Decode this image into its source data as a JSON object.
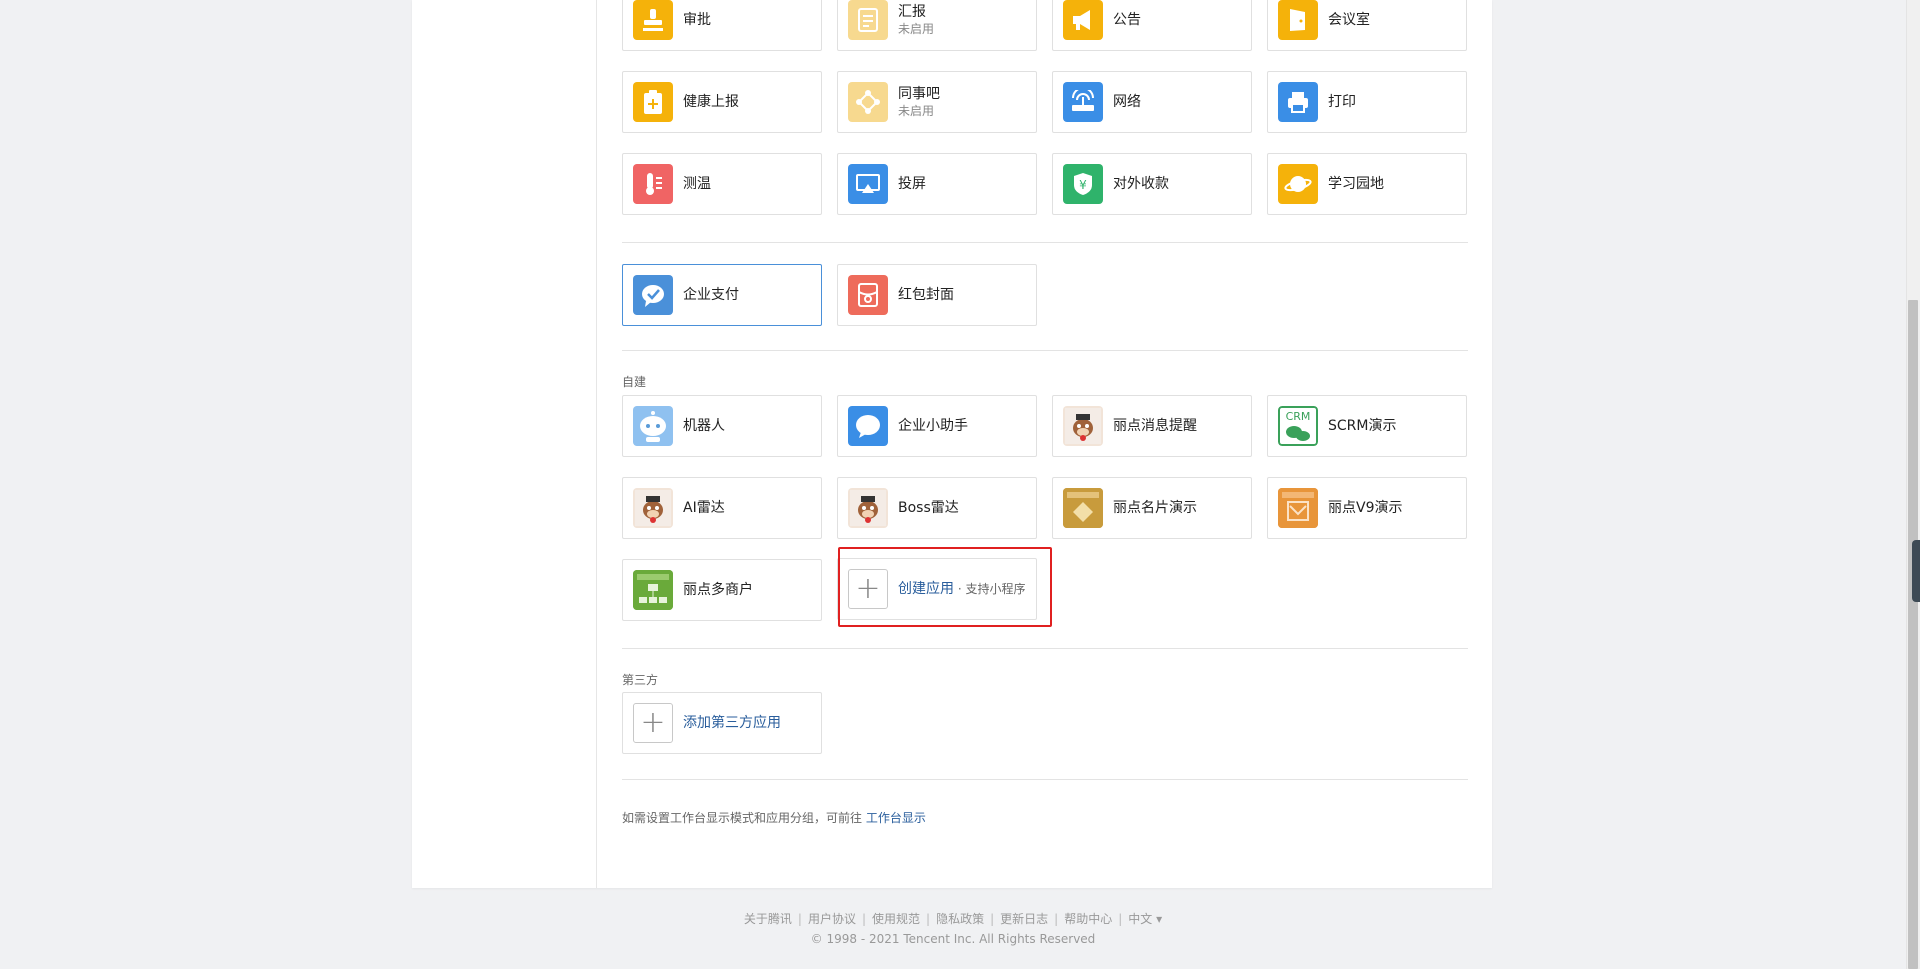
{
  "apps_builtin": [
    {
      "name": "审批",
      "sub": "",
      "icon": "stamp-icon",
      "color": "#f5b20a"
    },
    {
      "name": "汇报",
      "sub": "未启用",
      "icon": "report-icon",
      "color": "#f7d98f"
    },
    {
      "name": "公告",
      "sub": "",
      "icon": "megaphone-icon",
      "color": "#f5b20a"
    },
    {
      "name": "会议室",
      "sub": "",
      "icon": "door-icon",
      "color": "#f5b20a"
    },
    {
      "name": "健康上报",
      "sub": "",
      "icon": "health-clipboard-icon",
      "color": "#f5b20a"
    },
    {
      "name": "同事吧",
      "sub": "未启用",
      "icon": "share-diamond-icon",
      "color": "#f7d98f"
    },
    {
      "name": "网络",
      "sub": "",
      "icon": "router-icon",
      "color": "#3a8ee6"
    },
    {
      "name": "打印",
      "sub": "",
      "icon": "printer-icon",
      "color": "#3a8ee6"
    },
    {
      "name": "测温",
      "sub": "",
      "icon": "thermometer-icon",
      "color": "#f06464"
    },
    {
      "name": "投屏",
      "sub": "",
      "icon": "screencast-icon",
      "color": "#3a8ee6"
    },
    {
      "name": "对外收款",
      "sub": "",
      "icon": "yuan-shield-icon",
      "color": "#2fb36b"
    },
    {
      "name": "学习园地",
      "sub": "",
      "icon": "planet-icon",
      "color": "#f5b20a"
    }
  ],
  "apps_payment": [
    {
      "name": "企业支付",
      "icon": "wechat-pay-icon",
      "color": "#4a90d9"
    },
    {
      "name": "红包封面",
      "icon": "red-packet-icon",
      "color": "#ee6b5b"
    }
  ],
  "custom_section_label": "自建",
  "apps_custom": [
    {
      "name": "机器人",
      "icon": "robot-icon",
      "color": "#8fc1f0"
    },
    {
      "name": "企业小助手",
      "icon": "chat-bubble-icon",
      "color": "#3a8ee6"
    },
    {
      "name": "丽点消息提醒",
      "icon": "mascot-icon",
      "color": "#f2e4d8"
    },
    {
      "name": "SCRM演示",
      "icon": "crm-wechat-icon",
      "color": "#ffffff"
    },
    {
      "name": "AI雷达",
      "icon": "mascot-icon",
      "color": "#f2e4d8"
    },
    {
      "name": "Boss雷达",
      "icon": "mascot-icon",
      "color": "#f2e4d8"
    },
    {
      "name": "丽点名片演示",
      "icon": "card-logo-icon",
      "color": "#c89b3c"
    },
    {
      "name": "丽点V9演示",
      "icon": "v9-logo-icon",
      "color": "#e8953a"
    },
    {
      "name": "丽点多商户",
      "icon": "multi-merchant-icon",
      "color": "#6aaa3a"
    }
  ],
  "create_app": {
    "label": "创建应用",
    "hint": " · 支持小程序"
  },
  "third_party_section_label": "第三方",
  "add_third_party": {
    "label": "添加第三方应用"
  },
  "note": {
    "text": "如需设置工作台显示模式和应用分组，可前往 ",
    "link": "工作台显示"
  },
  "footer": {
    "links": [
      "关于腾讯",
      "用户协议",
      "使用规范",
      "隐私政策",
      "更新日志",
      "帮助中心",
      "中文 ▾"
    ],
    "copyright": "© 1998 - 2021 Tencent Inc. All Rights Reserved"
  }
}
